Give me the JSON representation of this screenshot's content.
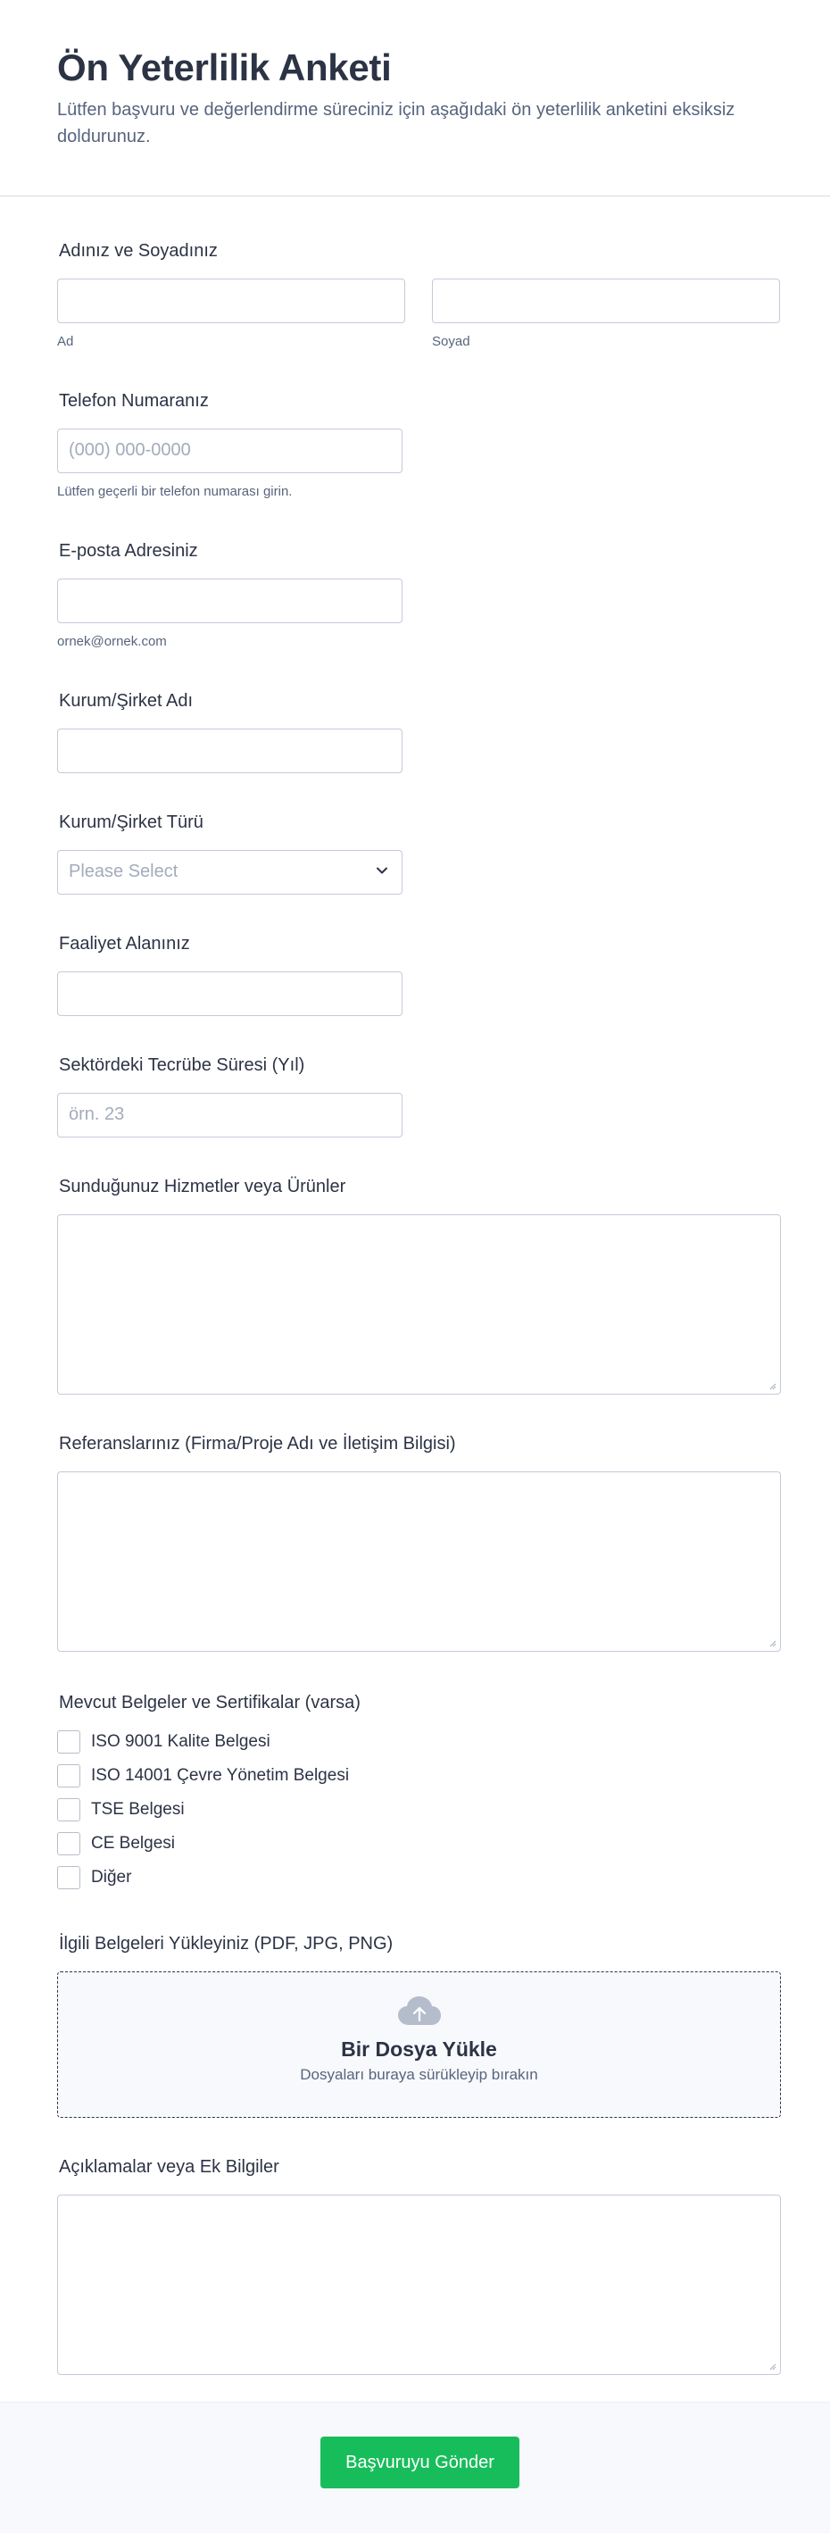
{
  "header": {
    "title": "Ön Yeterlilik Anketi",
    "description": "Lütfen başvuru ve değerlendirme süreciniz için aşağıdaki ön yeterlilik anketini eksiksiz doldurunuz."
  },
  "name": {
    "label": "Adınız ve Soyadınız",
    "first_sub": "Ad",
    "last_sub": "Soyad"
  },
  "phone": {
    "label": "Telefon Numaranız",
    "placeholder": "(000) 000-0000",
    "sub": "Lütfen geçerli bir telefon numarası girin."
  },
  "email": {
    "label": "E-posta Adresiniz",
    "sub": "ornek@ornek.com"
  },
  "company_name": {
    "label": "Kurum/Şirket Adı"
  },
  "company_type": {
    "label": "Kurum/Şirket Türü",
    "selected": "Please Select"
  },
  "activity": {
    "label": "Faaliyet Alanınız"
  },
  "experience": {
    "label": "Sektördeki Tecrübe Süresi (Yıl)",
    "placeholder": "örn. 23"
  },
  "services": {
    "label": "Sunduğunuz Hizmetler veya Ürünler"
  },
  "references": {
    "label": "Referanslarınız (Firma/Proje Adı ve İletişim Bilgisi)"
  },
  "certificates": {
    "label": "Mevcut Belgeler ve Sertifikalar (varsa)",
    "options": [
      "ISO 9001 Kalite Belgesi",
      "ISO 14001 Çevre Yönetim Belgesi",
      "TSE Belgesi",
      "CE Belgesi",
      "Diğer"
    ]
  },
  "upload": {
    "label": "İlgili Belgeleri Yükleyiniz (PDF, JPG, PNG)",
    "title": "Bir Dosya Yükle",
    "hint": "Dosyaları buraya sürükleyip bırakın",
    "icon": "cloud-upload-icon"
  },
  "notes": {
    "label": "Açıklamalar veya Ek Bilgiler"
  },
  "submit": {
    "label": "Başvuruyu Gönder"
  },
  "colors": {
    "submit": "#18bd5b",
    "text": "#2c3345",
    "muted": "#57647e",
    "border": "#c3cad8"
  }
}
